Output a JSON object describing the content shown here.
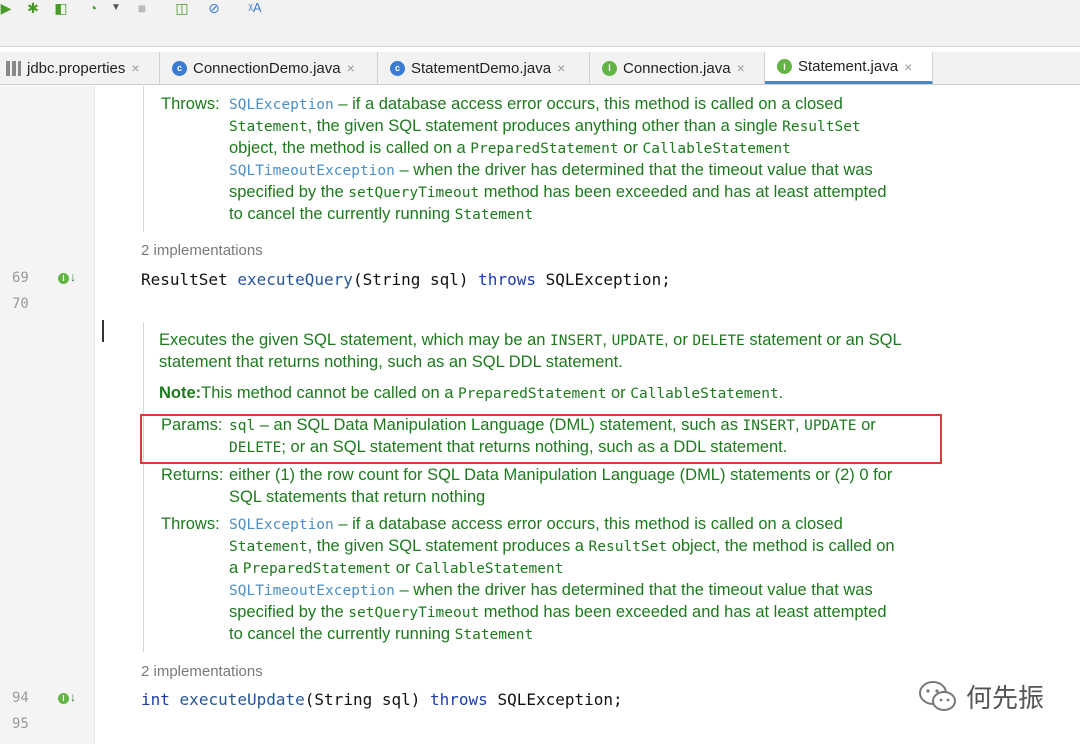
{
  "tabs": [
    {
      "label": "jdbc.properties",
      "icon": "properties-file-icon"
    },
    {
      "label": "ConnectionDemo.java",
      "icon": "class-icon"
    },
    {
      "label": "StatementDemo.java",
      "icon": "class-icon"
    },
    {
      "label": "Connection.java",
      "icon": "interface-icon"
    },
    {
      "label": "Statement.java",
      "icon": "interface-icon",
      "active": true
    }
  ],
  "tab_close": "×",
  "badges": {
    "class": "c",
    "interface": "I"
  },
  "gutter": {
    "lines": [
      "69",
      "70",
      "94",
      "95"
    ],
    "impl_marker": "↓"
  },
  "doc1": {
    "throws_label": "Throws:",
    "line1_ex": "SQLException",
    "line1_rest": " – if a database access error occurs, this method is called on a closed",
    "line2_a": "Statement",
    "line2_b": ", the given SQL statement produces anything other than a single ",
    "line2_c": "ResultSet",
    "line3_a": "object, the method is called on a ",
    "line3_b": "PreparedStatement",
    "line3_c": " or ",
    "line3_d": "CallableStatement",
    "line4_ex": "SQLTimeoutException",
    "line4_rest": " – when the driver has determined that the timeout value that was",
    "line5_a": "specified by the ",
    "line5_b": "setQueryTimeout",
    "line5_c": " method has been exceeded and has at least attempted",
    "line6_a": "to cancel the currently running ",
    "line6_b": "Statement"
  },
  "impl1": "2 implementations",
  "code1": {
    "type": "ResultSet",
    "method": "executeQuery",
    "params": "(String sql) ",
    "throws": "throws",
    "ex": " SQLException;"
  },
  "doc2": {
    "desc1_a": "Executes the given SQL statement, which may be an ",
    "desc1_b": "INSERT",
    "desc1_c": ", ",
    "desc1_d": "UPDATE",
    "desc1_e": ", or ",
    "desc1_f": "DELETE",
    "desc1_g": " statement or an SQL",
    "desc2": "statement that returns nothing, such as an SQL DDL statement.",
    "note_label": "Note:",
    "note_a": "This method cannot be called on a ",
    "note_b": "PreparedStatement",
    "note_c": " or ",
    "note_d": "CallableStatement",
    "note_e": ".",
    "params_label": "Params:",
    "params1_a": "sql",
    "params1_b": " – an SQL Data Manipulation Language (DML) statement, such as ",
    "params1_c": "INSERT",
    "params1_d": ", ",
    "params1_e": "UPDATE",
    "params1_f": " or",
    "params2_a": "DELETE",
    "params2_b": "; or an SQL statement that returns nothing, such as a DDL statement.",
    "returns_label": "Returns:",
    "returns1": "either (1) the row count for SQL Data Manipulation Language (DML) statements or (2) 0 for",
    "returns2": "SQL statements that return nothing",
    "throws_label": "Throws:",
    "t1_ex": "SQLException",
    "t1_rest": " – if a database access error occurs, this method is called on a closed",
    "t2_a": "Statement",
    "t2_b": ", the given SQL statement produces a ",
    "t2_c": "ResultSet",
    "t2_d": " object, the method is called on",
    "t3_a": "a ",
    "t3_b": "PreparedStatement",
    "t3_c": " or ",
    "t3_d": "CallableStatement",
    "t4_ex": "SQLTimeoutException",
    "t4_rest": " – when the driver has determined that the timeout value that was",
    "t5_a": "specified by the ",
    "t5_b": "setQueryTimeout",
    "t5_c": " method has been exceeded and has at least attempted",
    "t6_a": "to cancel the currently running ",
    "t6_b": "Statement"
  },
  "impl2": "2 implementations",
  "code2": {
    "type": "int",
    "method": "executeUpdate",
    "params": "(String sql) ",
    "throws": "throws",
    "ex": " SQLException;"
  },
  "watermark": "何先振",
  "colors": {
    "doc_green": "#1c7a1c",
    "link_blue": "#4a8fc7",
    "keyword": "#1a3cb0",
    "highlight_red": "#e0383c"
  }
}
